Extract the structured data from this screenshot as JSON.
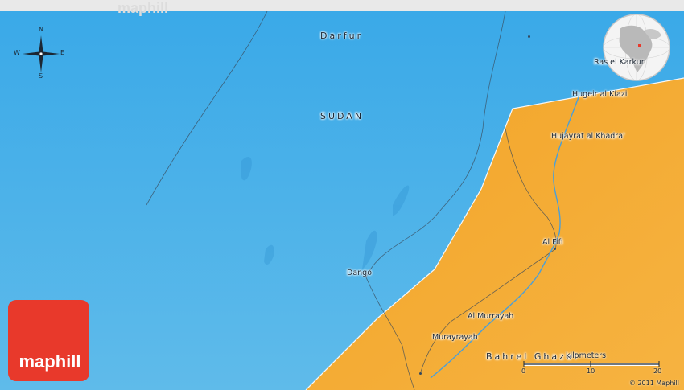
{
  "watermark": "maphill",
  "compass": {
    "north": "N",
    "south": "S",
    "east": "E",
    "west": "W"
  },
  "regions": [
    {
      "name": "Darfur"
    },
    {
      "name": "SUDAN"
    },
    {
      "name": "Bahrel Ghazal"
    }
  ],
  "places": [
    {
      "name": "Ras el Karkur"
    },
    {
      "name": "Hugeir al Kiazi"
    },
    {
      "name": "Hujayrat al Khadra'"
    },
    {
      "name": "Al Fifi"
    },
    {
      "name": "Dango"
    },
    {
      "name": "Al Murrayah"
    },
    {
      "name": "Murayrayah"
    }
  ],
  "scale": {
    "title": "kilometers",
    "ticks": [
      "0",
      "10",
      "20"
    ]
  },
  "copyright": "© 2011 Maphill",
  "logo": {
    "text": "maphill"
  },
  "colors": {
    "sudan": "#3aa7e6",
    "neighbor": "#f3a830",
    "logo": "#e8392b",
    "river": "#4a9fd8",
    "road": "#3a4a5a"
  }
}
